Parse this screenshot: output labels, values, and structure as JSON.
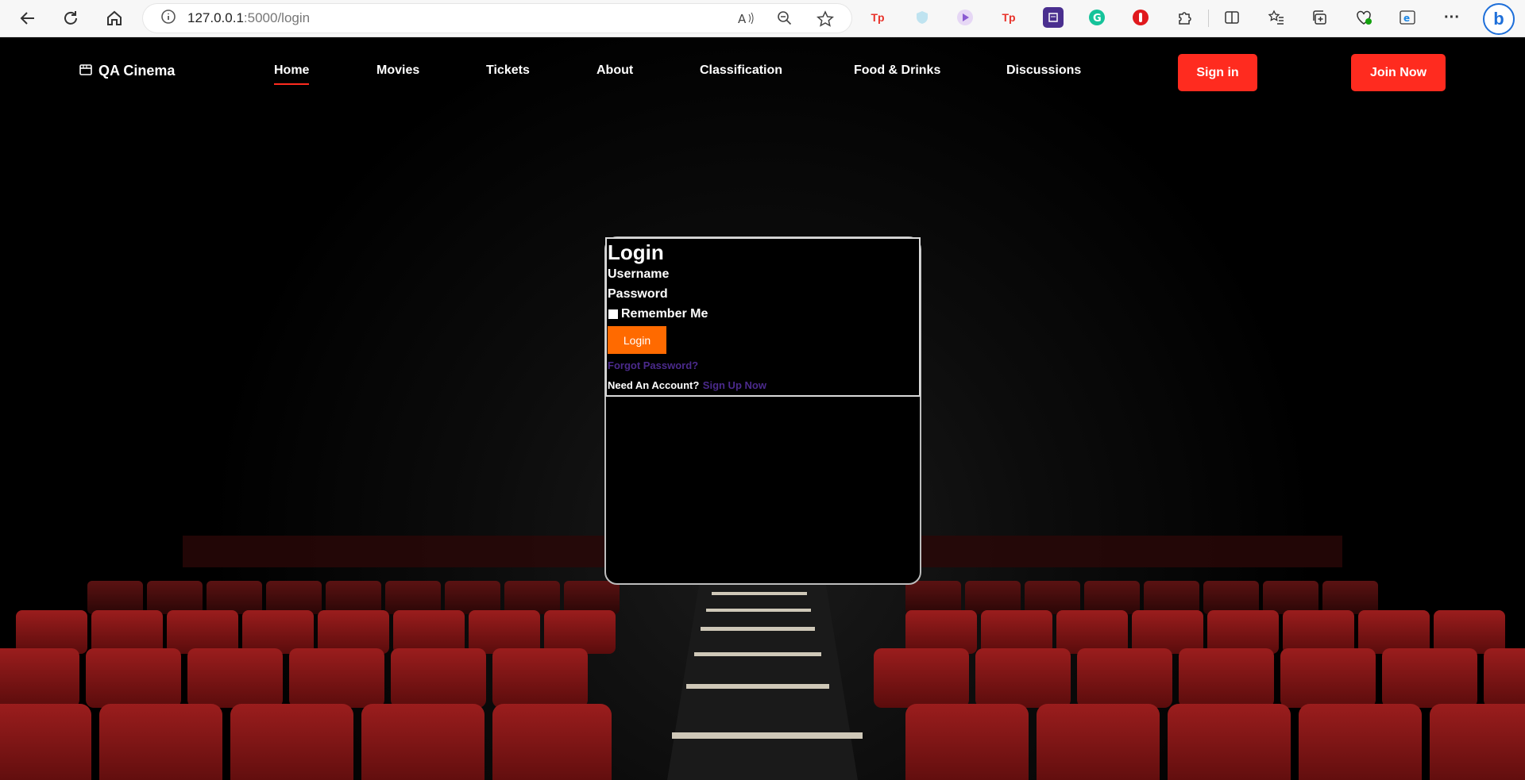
{
  "browser": {
    "url_host": "127.0.0.1",
    "url_rest": ":5000/login"
  },
  "site": {
    "logo_text": "QA Cinema",
    "nav": {
      "home": "Home",
      "movies": "Movies",
      "tickets": "Tickets",
      "about": "About",
      "classification": "Classification",
      "food": "Food & Drinks",
      "discussions": "Discussions"
    },
    "sign_in": "Sign in",
    "join_now": "Join Now"
  },
  "login": {
    "title": "Login",
    "username_label": "Username",
    "password_label": "Password",
    "remember_label": "Remember Me",
    "submit_label": "Login",
    "forgot_link": "Forgot Password?",
    "need_account": "Need An Account?",
    "signup_link": "Sign Up Now"
  },
  "colors": {
    "accent_red": "#ff2b1f",
    "login_button": "#ff6a00",
    "link_purple": "#4b2a8c",
    "seat_red": "#7a1414"
  }
}
